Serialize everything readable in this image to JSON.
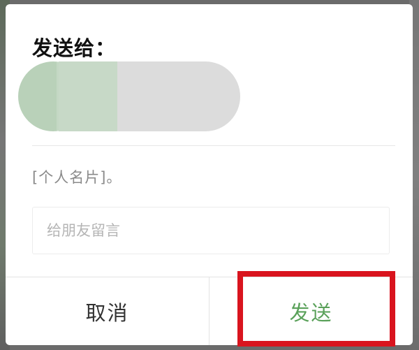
{
  "dialog": {
    "title": "发送给：",
    "card_text": "[个人名片]。",
    "message": {
      "value": "",
      "placeholder": "给朋友留言"
    },
    "buttons": {
      "cancel_label": "取消",
      "send_label": "发送"
    }
  },
  "colors": {
    "send_accent": "#5aa15a",
    "highlight_border": "#d9141e"
  }
}
